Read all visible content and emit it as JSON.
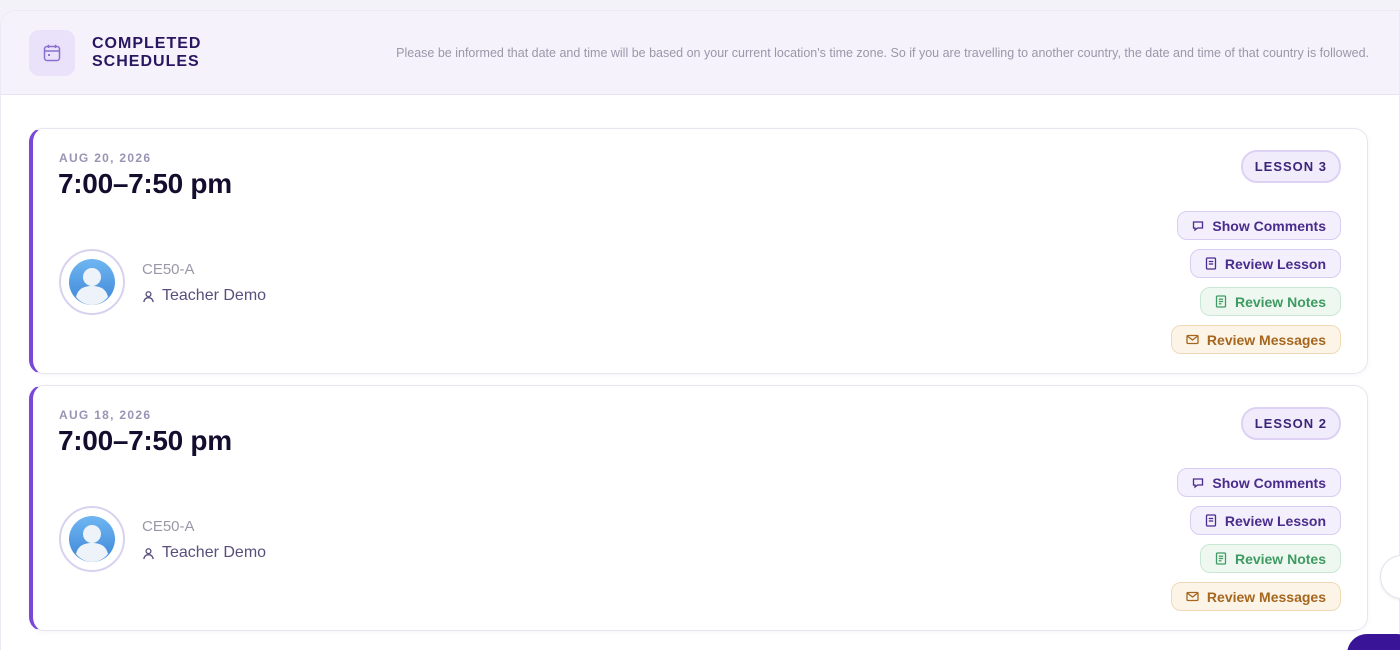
{
  "header": {
    "title": "COMPLETED SCHEDULES",
    "notice": "Please be informed that date and time will be based on your current location's time zone. So if you are travelling to another country, the date and time of that country is followed.",
    "icon": "calendar-icon"
  },
  "schedules": [
    {
      "date": "AUG 20, 2026",
      "time": "7:00–7:50 pm",
      "class_code": "CE50-A",
      "teacher": "Teacher Demo",
      "lesson": "LESSON 3",
      "actions": {
        "show_comments": "Show Comments",
        "review_lesson": "Review Lesson",
        "review_notes": "Review Notes",
        "review_messages": "Review Messages"
      }
    },
    {
      "date": "AUG 18, 2026",
      "time": "7:00–7:50 pm",
      "class_code": "CE50-A",
      "teacher": "Teacher Demo",
      "lesson": "LESSON 2",
      "actions": {
        "show_comments": "Show Comments",
        "review_lesson": "Review Lesson",
        "review_notes": "Review Notes",
        "review_messages": "Review Messages"
      }
    }
  ],
  "colors": {
    "accent": "#7a48d6",
    "title": "#2a1560",
    "notes_green": "#3f9a62",
    "messages_orange": "#a5661e"
  }
}
